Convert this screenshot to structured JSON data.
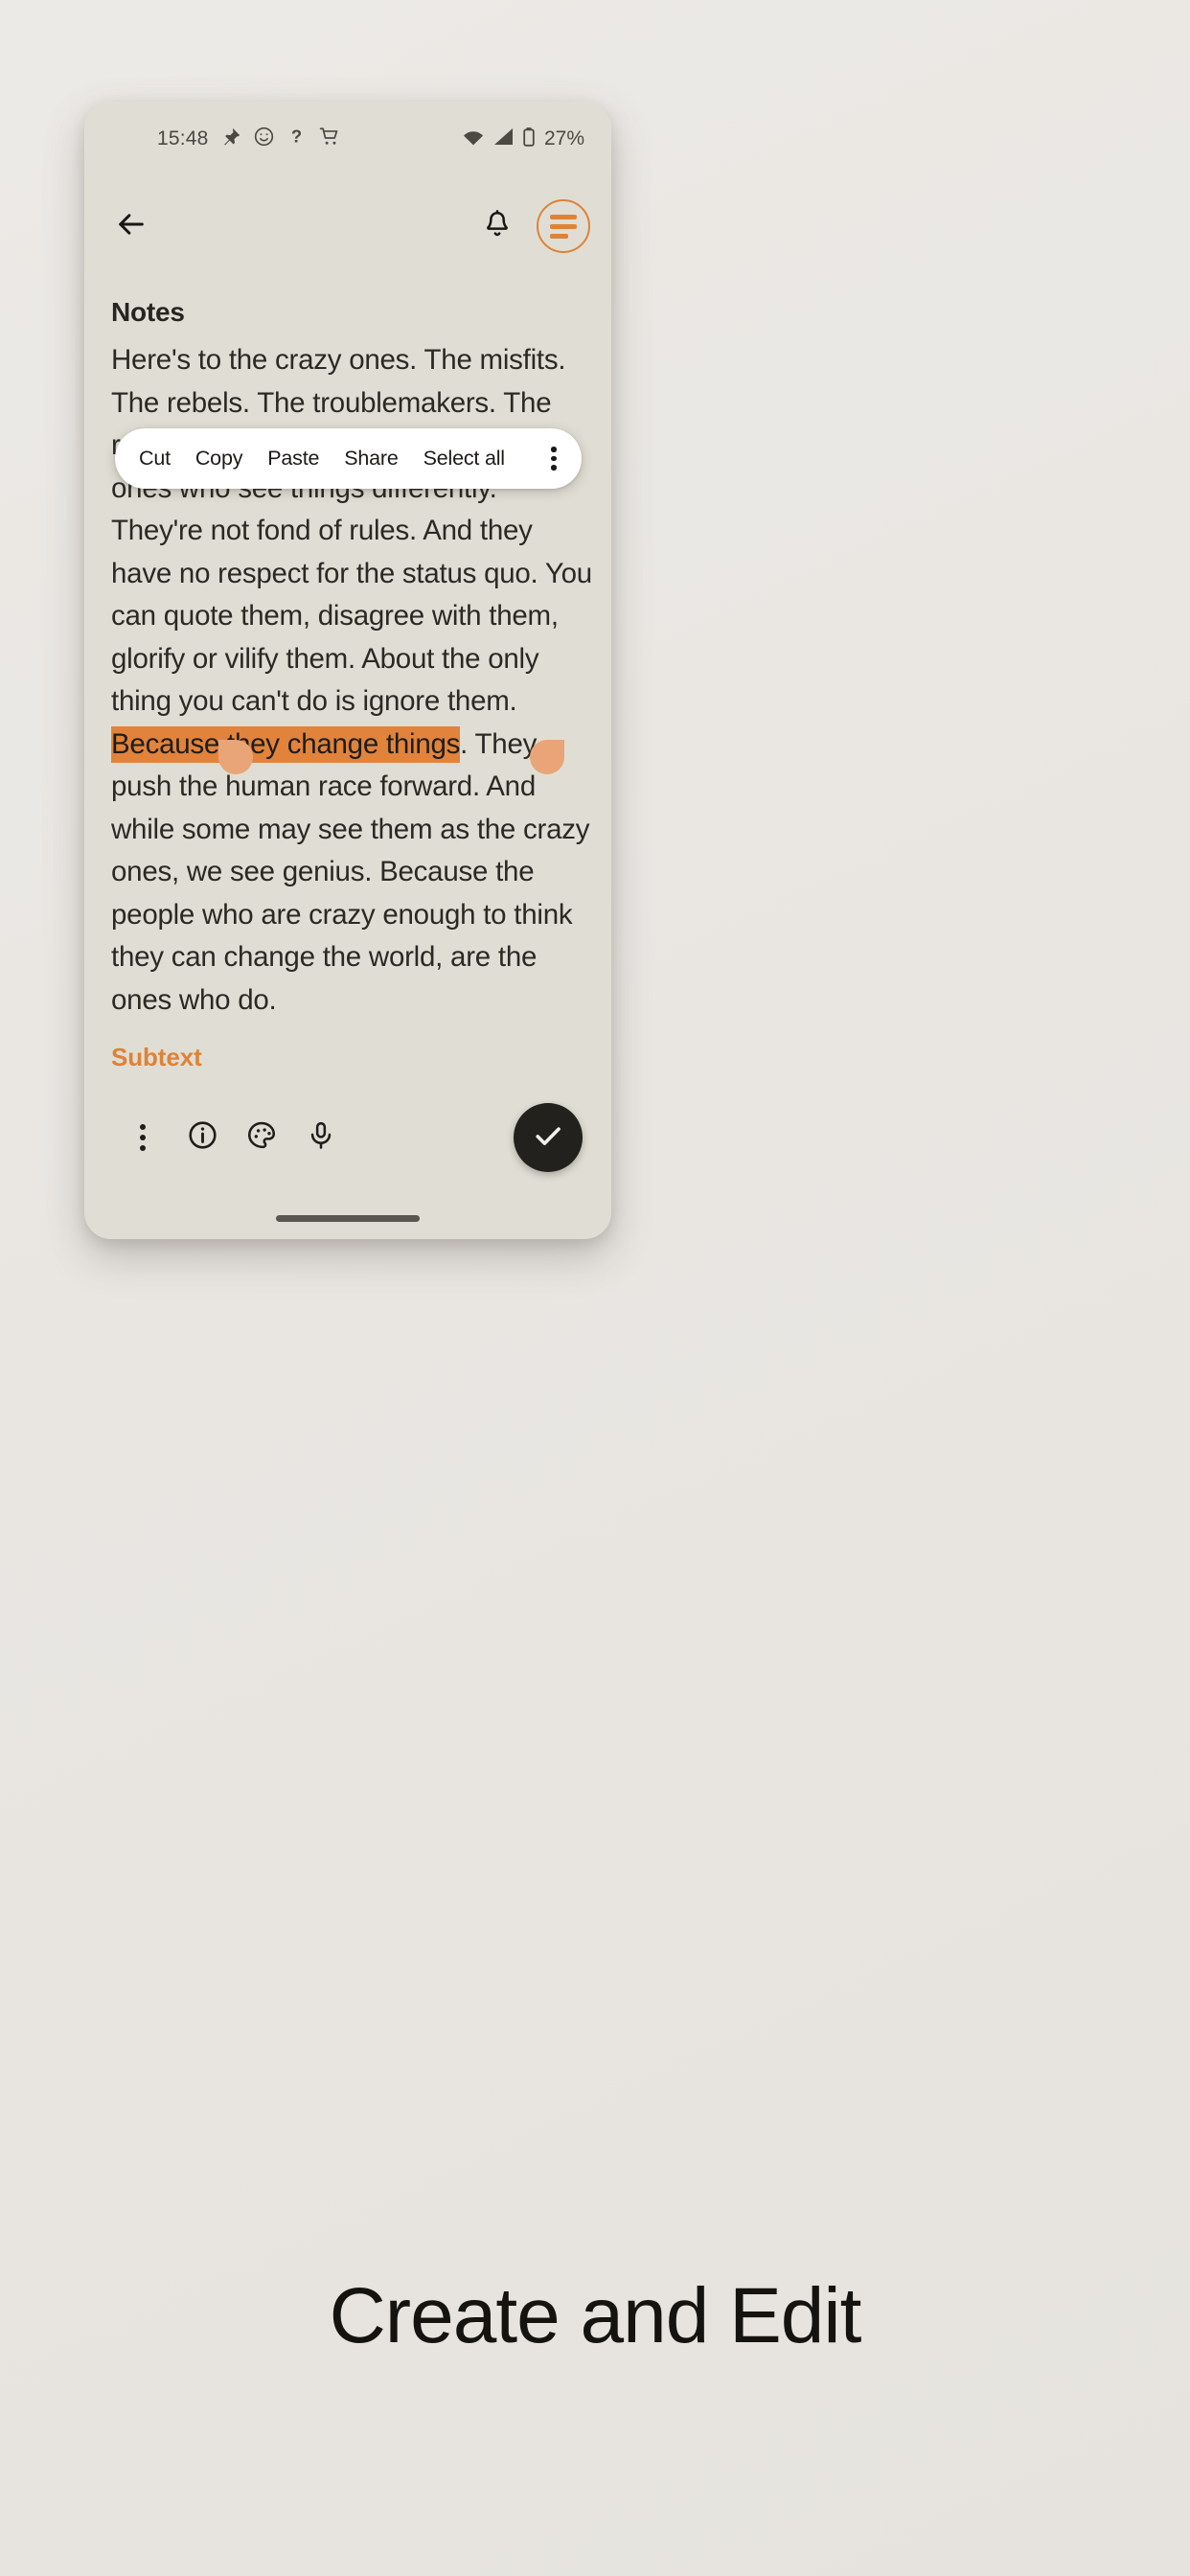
{
  "statusbar": {
    "clock": "15:48",
    "icons_left": [
      "pin-icon",
      "emoji-icon",
      "help-icon",
      "cart-icon"
    ],
    "icons_right": [
      "wifi-icon",
      "signal-icon",
      "battery-icon"
    ],
    "battery_percent": "27%"
  },
  "appbar": {
    "back_icon": "arrow-left-icon",
    "bell_icon": "bell-icon",
    "menu_icon": "hamburger-icon",
    "accent_color": "#e08236"
  },
  "note": {
    "title": "Notes",
    "body_before_selection": "Here's to the crazy ones. The misfits. The rebels. The troublemakers. The round pegs in the square holes. The ones who see things differently. They're not fond of rules. And they have no respect for the status quo. You can quote them, disagree with them, glorify or vilify them. About the only thing you can't do is ignore them. ",
    "body_selection": "Because they change things",
    "body_after_selection": ". They push the human race forward. And while some may see them as the crazy ones, we see genius. Because the people who are crazy enough to think they can change the world, are the ones who do.",
    "subtext": "Subtext",
    "selection_highlight_color": "#e2833b",
    "handle_color": "#e9a577",
    "subtext_color": "#de8238"
  },
  "context_menu": {
    "items": [
      {
        "label": "Cut"
      },
      {
        "label": "Copy"
      },
      {
        "label": "Paste"
      },
      {
        "label": "Share"
      },
      {
        "label": "Select all"
      }
    ],
    "overflow_icon": "more-vertical-icon"
  },
  "bottom_toolbar": {
    "tools": [
      {
        "icon": "more-vertical-icon"
      },
      {
        "icon": "info-circle-icon"
      },
      {
        "icon": "palette-icon"
      },
      {
        "icon": "microphone-icon"
      }
    ],
    "fab": {
      "icon": "check-icon",
      "color": "#23211e"
    }
  },
  "caption": "Create and Edit"
}
